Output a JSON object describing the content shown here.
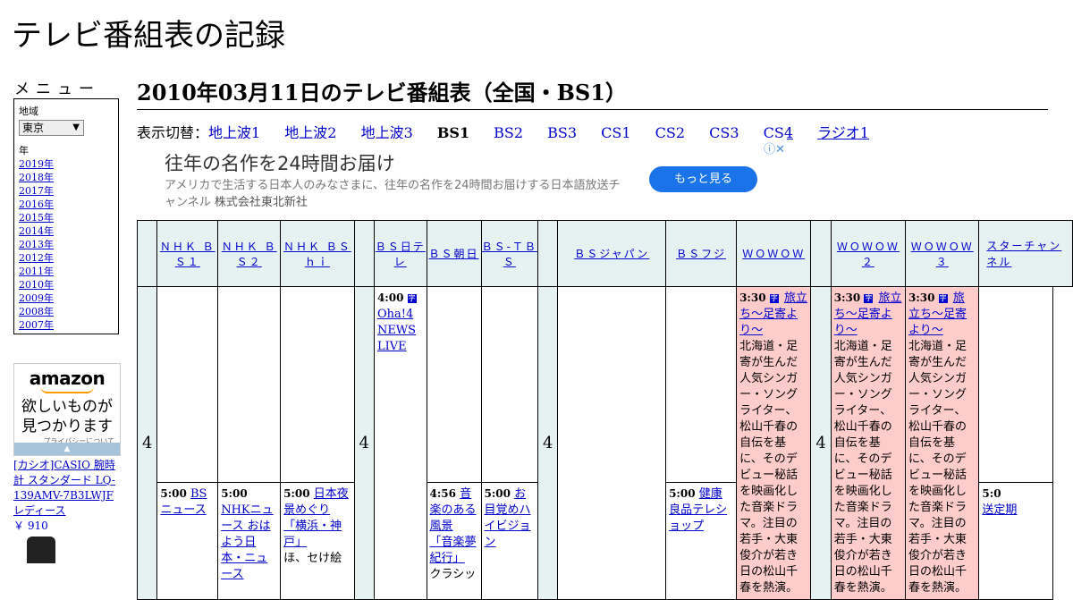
{
  "site": {
    "title": "テレビ番組表の記録"
  },
  "menu": {
    "title": "メニュー",
    "region_label": "地域",
    "region_value": "東京",
    "year_label": "年",
    "years": [
      "2019年",
      "2018年",
      "2017年",
      "2016年",
      "2015年",
      "2014年",
      "2013年",
      "2012年",
      "2011年",
      "2010年",
      "2009年",
      "2008年",
      "2007年"
    ]
  },
  "amazon_ad": {
    "logo": "amazon",
    "catch_line1": "欲しいものが",
    "catch_line2": "見つかります",
    "privacy": "プライバシーについて",
    "product": "[カシオ]CASIO 腕時計 スタンダード LQ-139AMV-7B3LWJF レディース",
    "price": "￥ 910"
  },
  "page": {
    "heading": "2010年03月11日のテレビ番組表（全国・BS1）"
  },
  "switcher": {
    "label": "表示切替：",
    "links": [
      "地上波1",
      "地上波2",
      "地上波3",
      "BS1",
      "BS2",
      "BS3",
      "CS1",
      "CS2",
      "CS3",
      "CS4",
      "ラジオ1"
    ],
    "current": "BS1"
  },
  "banner_ad": {
    "title": "往年の名作を24時間お届け",
    "desc": "アメリカで生活する日本人のみなさまに、往年の名作を24時間お届けする日本語放送チャンネル",
    "company": "株式会社東北新社",
    "button": "もっと見る",
    "icons": "ⓘ✕"
  },
  "channels": [
    "ＮＨＫ ＢＳ１",
    "ＮＨＫ ＢＳ２",
    "ＮＨＫ ＢＳｈｉ",
    "ＢＳ日テレ",
    "ＢＳ朝日",
    "ＢＳ-ＴＢＳ",
    "ＢＳジャパン",
    "ＢＳフジ",
    "ＷＯＷＯＷ",
    "ＷＯＷＯＷ２",
    "ＷＯＷＯＷ３",
    "スターチャンネル"
  ],
  "hour": "4",
  "programs": {
    "ntv_400": {
      "time": "4:00",
      "title": "Oha!4 NEWS LIVE"
    },
    "asahi_456": {
      "time": "4:56",
      "title": "音楽のある風景 「音楽夢紀行」",
      "desc": "クラシッ"
    },
    "bs1_500": {
      "time": "5:00",
      "title": "BSニュース"
    },
    "bs2_500": {
      "time": "5:00",
      "title": "NHKニュース おはよう日本・ニュース"
    },
    "bshi_500": {
      "time": "5:00",
      "title": "日本夜景めぐり「横浜・神戸」",
      "desc": "ほ、セけ絵"
    },
    "tbs_500": {
      "time": "5:00",
      "title": "お目覚めハイビジョン"
    },
    "fuji_500": {
      "time": "5:00",
      "title": "健康良品テレショップ"
    },
    "wowow_330": {
      "time": "3:30",
      "title": "旅立ち～足寄より～",
      "desc": "北海道・足寄が生んだ人気シンガー・ソングライター、松山千春の自伝を基に、そのデビュー秘話を映画化した音楽ドラマ。注目の若手・大東俊介が若き日の松山千春を熱演。"
    },
    "star_500": {
      "time": "5:0",
      "title": "送定期"
    }
  }
}
